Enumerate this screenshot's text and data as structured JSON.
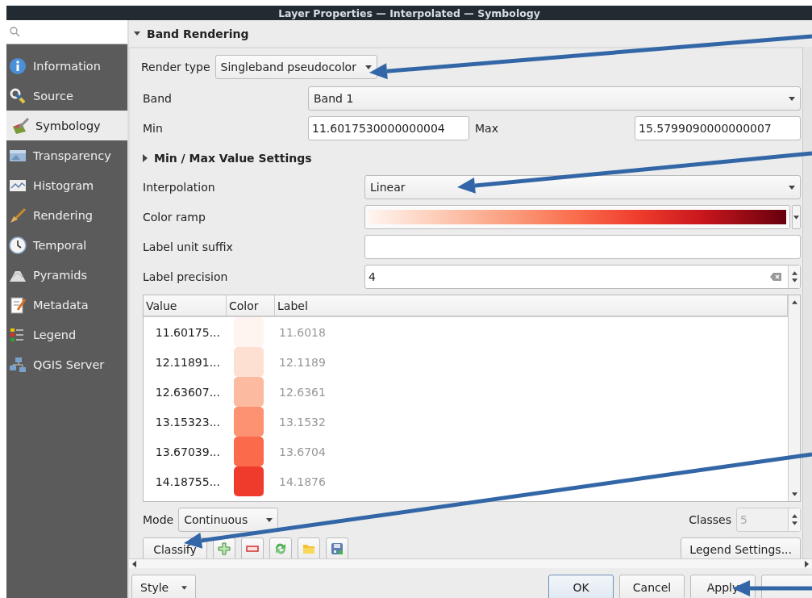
{
  "window": {
    "title": "Layer Properties — Interpolated — Symbology"
  },
  "sidebar": {
    "items": [
      {
        "label": "Information",
        "selected": false
      },
      {
        "label": "Source",
        "selected": false
      },
      {
        "label": "Symbology",
        "selected": true
      },
      {
        "label": "Transparency",
        "selected": false
      },
      {
        "label": "Histogram",
        "selected": false
      },
      {
        "label": "Rendering",
        "selected": false
      },
      {
        "label": "Temporal",
        "selected": false
      },
      {
        "label": "Pyramids",
        "selected": false
      },
      {
        "label": "Metadata",
        "selected": false
      },
      {
        "label": "Legend",
        "selected": false
      },
      {
        "label": "QGIS Server",
        "selected": false
      }
    ]
  },
  "section": {
    "title": "Band Rendering",
    "expanded": true
  },
  "render_type": {
    "label": "Render type",
    "value": "Singleband pseudocolor"
  },
  "band": {
    "label": "Band",
    "value": "Band 1"
  },
  "min": {
    "label": "Min",
    "value": "11.6017530000000004"
  },
  "max": {
    "label": "Max",
    "value": "15.5799090000000007"
  },
  "min_max_settings": {
    "label": "Min / Max Value Settings",
    "expanded": false
  },
  "interpolation": {
    "label": "Interpolation",
    "value": "Linear"
  },
  "color_ramp": {
    "label": "Color ramp"
  },
  "label_unit_suffix": {
    "label": "Label unit suffix"
  },
  "label_precision": {
    "label": "Label precision",
    "value": "4"
  },
  "table": {
    "columns": [
      "Value",
      "Color",
      "Label"
    ],
    "rows": [
      {
        "value": "11.60175...",
        "color": "#fff5f0",
        "label": "11.6018"
      },
      {
        "value": "12.11891...",
        "color": "#fee0d2",
        "label": "12.1189"
      },
      {
        "value": "12.63607...",
        "color": "#fcbba1",
        "label": "12.6361"
      },
      {
        "value": "13.15323...",
        "color": "#fc9272",
        "label": "13.1532"
      },
      {
        "value": "13.67039...",
        "color": "#fb6a4a",
        "label": "13.6704"
      },
      {
        "value": "14.18755...",
        "color": "#ef3b2c",
        "label": "14.1876"
      }
    ]
  },
  "mode": {
    "label": "Mode",
    "value": "Continuous"
  },
  "classes": {
    "label": "Classes",
    "value": "5",
    "disabled": true
  },
  "classify_button": "Classify",
  "legend_settings_button": "Legend Settings...",
  "footer": {
    "style_button": "Style",
    "buttons": [
      {
        "label": "OK",
        "default": true
      },
      {
        "label": "Cancel",
        "default": false
      },
      {
        "label": "Apply",
        "default": false
      },
      {
        "default": false
      }
    ]
  }
}
